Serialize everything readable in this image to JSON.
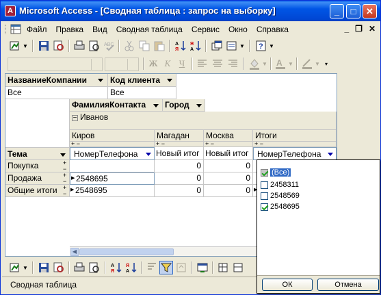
{
  "window": {
    "title": "Microsoft Access - [Сводная таблица : запрос на выборку]"
  },
  "menu": {
    "items": [
      "Файл",
      "Правка",
      "Вид",
      "Сводная таблица",
      "Сервис",
      "Окно",
      "Справка"
    ]
  },
  "pivot": {
    "filter_fields": [
      {
        "name": "НазваниеКомпании",
        "value": "Все"
      },
      {
        "name": "Код клиента",
        "value": "Все"
      }
    ],
    "column_fields": [
      "ФамилияКонтакта",
      "Город"
    ],
    "contact_group": "Иванов",
    "cities": [
      "Киров",
      "Магадан",
      "Москва",
      "Итоги"
    ],
    "row_field": "Тема",
    "data_field": "НомерТелефона",
    "total_label": "Новый итог",
    "rows": [
      {
        "label": "Покупка",
        "kirov": "",
        "magadan": "0",
        "moscow": "0"
      },
      {
        "label": "Продажа",
        "kirov": "2548695",
        "magadan": "0",
        "moscow": "0"
      },
      {
        "label": "Общие итоги",
        "kirov": "2548695",
        "magadan": "0",
        "moscow": "0"
      }
    ]
  },
  "filter_popup": {
    "items": [
      {
        "label": "(Все)",
        "checked": true
      },
      {
        "label": "2458311",
        "checked": false
      },
      {
        "label": "2548569",
        "checked": false
      },
      {
        "label": "2548695",
        "checked": true
      }
    ],
    "ok_label": "ОК",
    "cancel_label": "Отмена"
  },
  "status": {
    "text": "Сводная таблица"
  },
  "colors": {
    "title_bar": "#0055e5",
    "selection": "#316ac5"
  }
}
